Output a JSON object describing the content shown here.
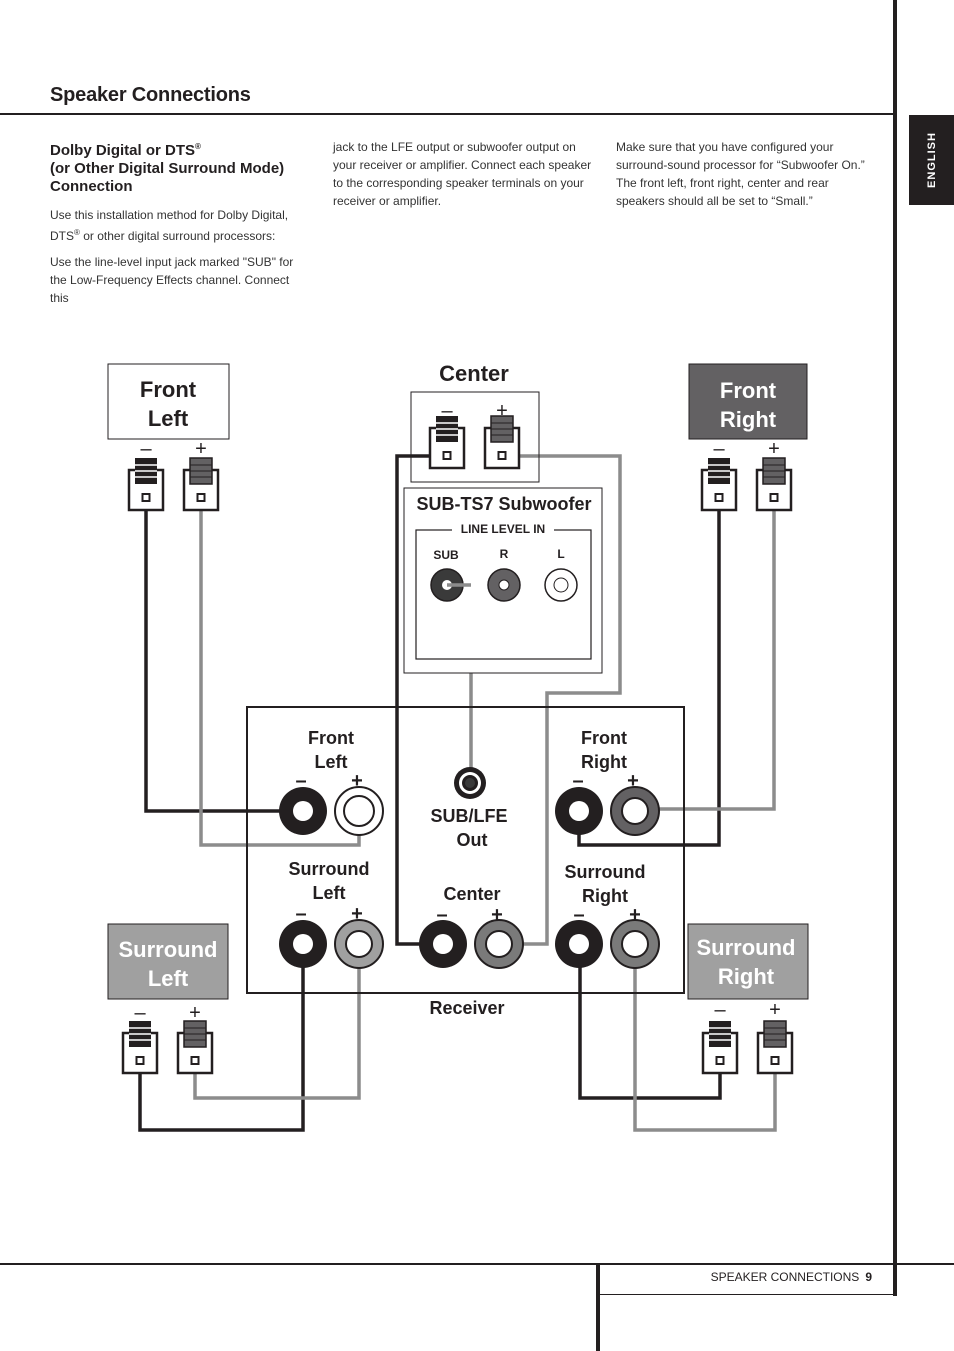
{
  "header": {
    "title": "Speaker Connections",
    "language_tab": "ENGLISH"
  },
  "body": {
    "heading_line1": "Dolby Digital or DTS",
    "heading_reg": "®",
    "heading_line2": "(or Other Digital Surround Mode)",
    "heading_line3": "Connection",
    "col1_p1_a": "Use this installation method for Dolby Digital, DTS",
    "col1_p1_reg": "®",
    "col1_p1_b": " or other digital surround processors:",
    "col1_p2": "Use the line-level input jack marked \"SUB\" for the Low-Frequency Effects channel. Connect this",
    "col2_p1": "jack to the LFE output or subwoofer output on your receiver or amplifier. Connect each speaker to the corresponding speaker terminals on your receiver or amplifier.",
    "col3_p1": "Make sure that you have configured your surround-sound processor for “Subwoofer On.” The front left, front right, center and rear speakers should all be set to “Small.”"
  },
  "diagram": {
    "speakers": {
      "front_left": [
        "Front",
        "Left"
      ],
      "front_right": [
        "Front",
        "Right"
      ],
      "center": "Center",
      "surround_left": [
        "Surround",
        "Left"
      ],
      "surround_right": [
        "Surround",
        "Right"
      ]
    },
    "subwoofer": {
      "title": "SUB-TS7 Subwoofer",
      "panel_label": "LINE LEVEL IN",
      "jacks": [
        "SUB",
        "R",
        "L"
      ]
    },
    "receiver": {
      "label": "Receiver",
      "front_left": [
        "Front",
        "Left"
      ],
      "front_right": [
        "Front",
        "Right"
      ],
      "surround_left": [
        "Surround",
        "Left"
      ],
      "surround_right": [
        "Surround",
        "Right"
      ],
      "center": "Center",
      "sub_out": [
        "SUB/LFE",
        "Out"
      ]
    },
    "polarity": {
      "neg": "–",
      "pos": "+"
    },
    "colors": {
      "neg_wire": "#231f20",
      "pos_wire": "#8c8c8c",
      "front_right_box": "#636163",
      "surround_box": "#a0a0a0",
      "text": "#231f20"
    }
  },
  "footer": {
    "section": "SPEAKER CONNECTIONS",
    "page": "9"
  }
}
